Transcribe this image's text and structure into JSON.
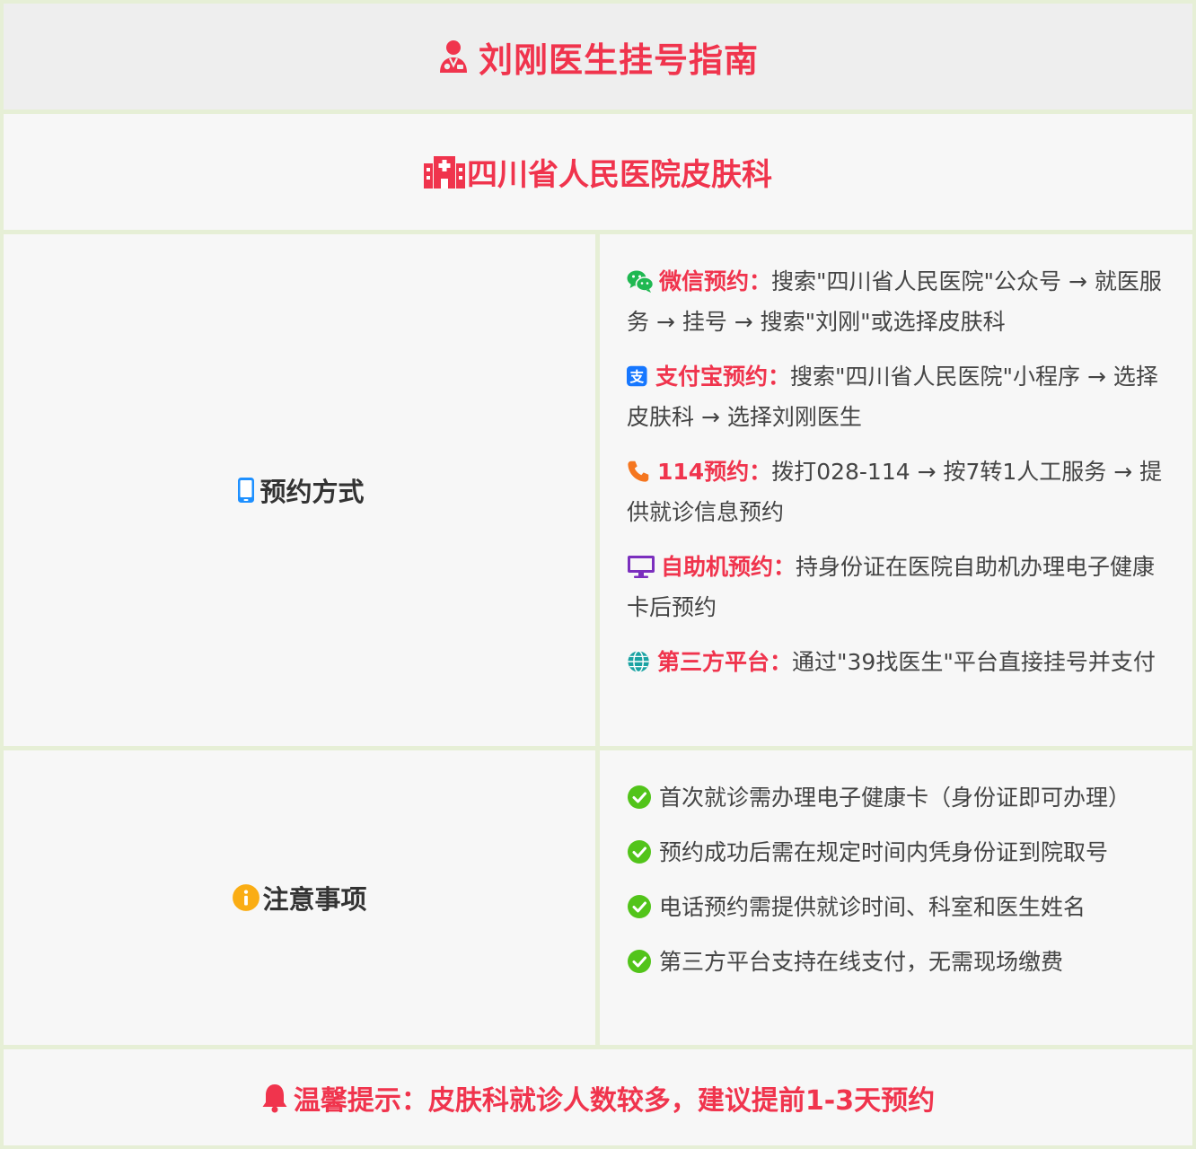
{
  "title": {
    "icon": "doctor-icon",
    "text": "刘刚医生挂号指南",
    "color": "#f0344d"
  },
  "hospital": {
    "icon": "hospital-icon",
    "text": "四川省人民医院皮肤科"
  },
  "booking": {
    "label_icon": "mobile-phone-icon",
    "label": "预约方式",
    "methods": [
      {
        "icon": "wechat-icon",
        "name": "微信预约：",
        "desc": "搜索\"四川省人民医院\"公众号 → 就医服务 → 挂号 → 搜索\"刘刚\"或选择皮肤科"
      },
      {
        "icon": "alipay-icon",
        "name": "支付宝预约：",
        "desc": "搜索\"四川省人民医院\"小程序 → 选择皮肤科 → 选择刘刚医生"
      },
      {
        "icon": "phone-icon",
        "name": "114预约：",
        "desc": "拨打028-114 → 按7转1人工服务 → 提供就诊信息预约"
      },
      {
        "icon": "kiosk-monitor-icon",
        "name": "自助机预约：",
        "desc": "持身份证在医院自助机办理电子健康卡后预约"
      },
      {
        "icon": "globe-icon",
        "name": "第三方平台：",
        "desc": "通过\"39找医生\"平台直接挂号并支付"
      }
    ]
  },
  "notes": {
    "label_icon": "info-icon",
    "label": "注意事项",
    "items": [
      {
        "icon": "check-circle-icon",
        "text": "首次就诊需办理电子健康卡（身份证即可办理）"
      },
      {
        "icon": "check-circle-icon",
        "text": "预约成功后需在规定时间内凭身份证到院取号"
      },
      {
        "icon": "check-circle-icon",
        "text": "电话预约需提供就诊时间、科室和医生姓名"
      },
      {
        "icon": "check-circle-icon",
        "text": "第三方平台支持在线支付，无需现场缴费"
      }
    ]
  },
  "tip": {
    "icon": "bell-icon",
    "text": "温馨提示：皮肤科就诊人数较多，建议提前1-3天预约"
  },
  "colors": {
    "accent": "#f0344d",
    "border": "#e6efd6",
    "wechat": "#1fb851",
    "alipay": "#1677ff",
    "phone": "#f5761f",
    "kiosk": "#7b2fbe",
    "globe": "#1aa3a3",
    "check": "#52c41a",
    "info": "#faad14"
  }
}
